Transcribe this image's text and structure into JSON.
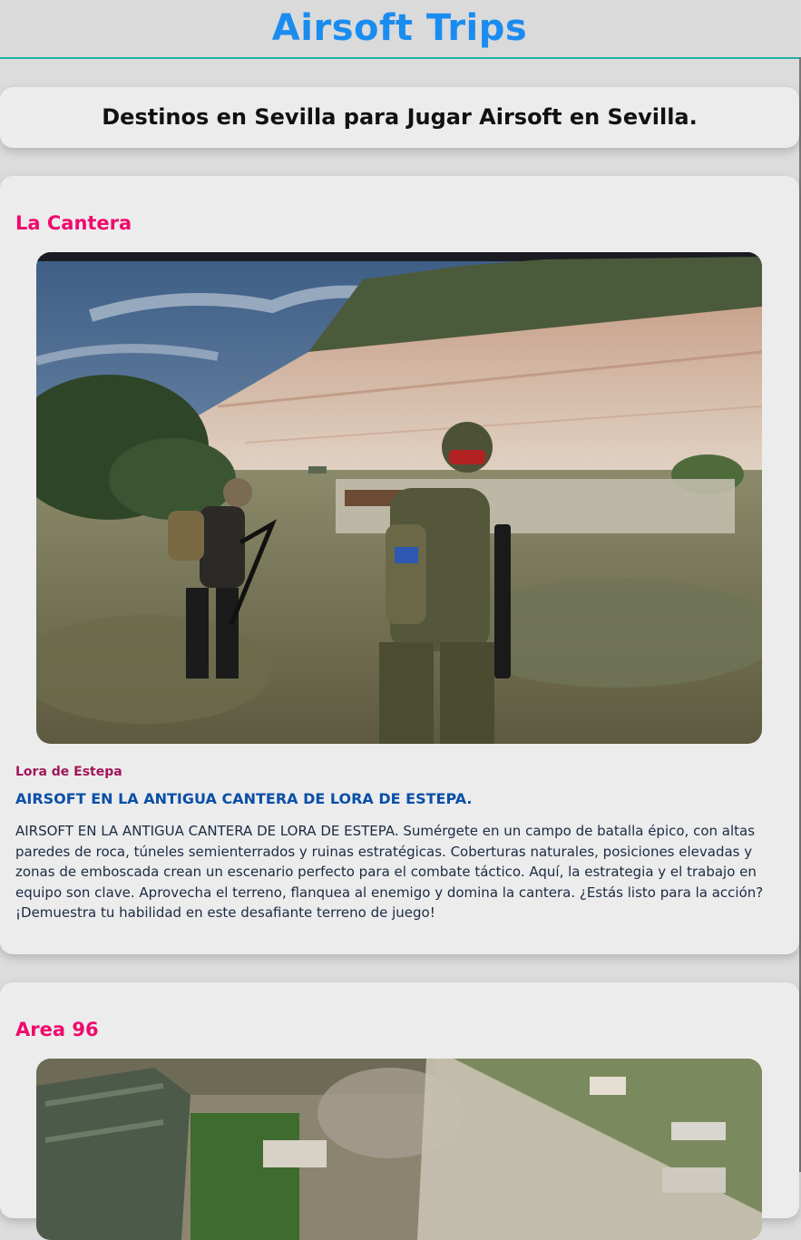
{
  "site": {
    "title": "Airsoft Trips"
  },
  "intro": {
    "heading": "Destinos en Sevilla para Jugar Airsoft en Sevilla."
  },
  "destinations": [
    {
      "name": "La Cantera",
      "image_alt": "Jugadores de airsoft equipados en una antigua cantera",
      "location": "Lora de Estepa",
      "headline": "AIRSOFT EN LA ANTIGUA CANTERA DE LORA DE ESTEPA.",
      "description": "AIRSOFT EN LA ANTIGUA CANTERA DE LORA DE ESTEPA. Sumérgete en un campo de batalla épico, con altas paredes de roca, túneles semienterrados y ruinas estratégicas. Coberturas naturales, posiciones elevadas y zonas de emboscada crean un escenario perfecto para el combate táctico. Aquí, la estrategia y el trabajo en equipo son clave. Aprovecha el terreno, flanquea al enemigo y domina la cantera. ¿Estás listo para la acción? ¡Demuestra tu habilidad en este desafiante terreno de juego!"
    },
    {
      "name": "Area 96",
      "image_alt": "Vista aérea del campo de airsoft con edificios abandonados"
    }
  ],
  "colors": {
    "title_blue": "#1a8cf0",
    "accent_pink": "#ef0a6e",
    "location_magenta": "#a0185a",
    "headline_blue": "#0a4fa8",
    "header_rule": "#20b2aa"
  }
}
